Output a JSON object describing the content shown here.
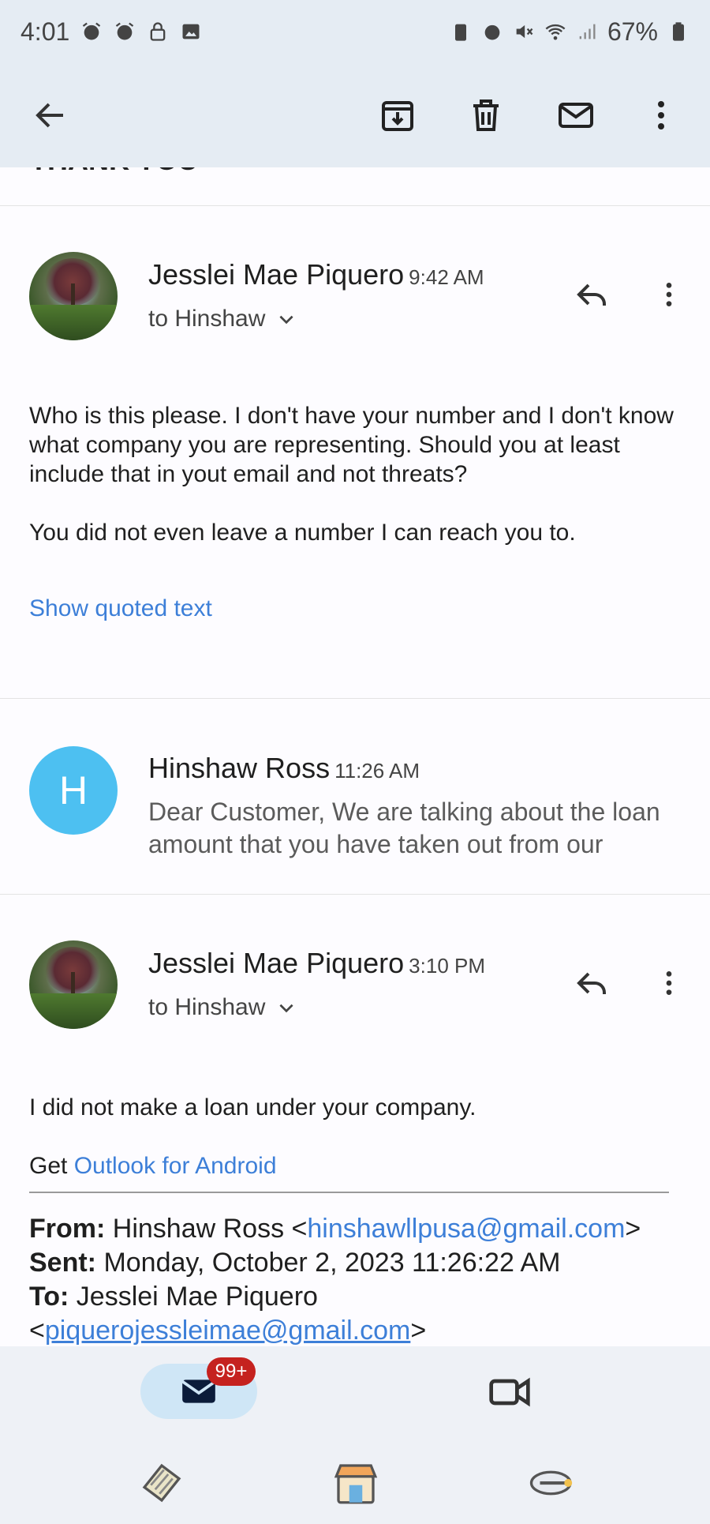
{
  "status_bar": {
    "time": "4:01",
    "battery": "67%"
  },
  "app_bar": {
    "icons": [
      "back-arrow-icon",
      "archive-icon",
      "delete-icon",
      "mark-unread-icon",
      "more-vert-icon"
    ]
  },
  "messages": [
    {
      "sender": "Jesslei Mae Piquero",
      "time": "9:42 AM",
      "recipient": "to Hinshaw",
      "body": [
        "Who is this please. I don't have your number and I don't know what company you are representing. Should you at least include that in yout email and not threats?",
        "You did not even leave a number I can reach you to."
      ],
      "show_quoted": "Show quoted text"
    },
    {
      "sender": "Hinshaw Ross",
      "avatar_letter": "H",
      "time": "11:26 AM",
      "snippet": "Dear Customer, We are talking about the loan amount that you have taken out from our"
    },
    {
      "sender": "Jesslei Mae Piquero",
      "time": "3:10 PM",
      "recipient": "to Hinshaw",
      "body": [
        "I did not make a loan under your company."
      ],
      "signature_prefix": "Get ",
      "signature_link": "Outlook for Android",
      "quoted_header": {
        "from_label": "From:",
        "from_name": "Hinshaw Ross <",
        "from_email": "hinshawllpusa@gmail.com",
        "from_close": ">",
        "sent_label": "Sent:",
        "sent_value": "Monday, October 2, 2023 11:26:22 AM",
        "to_label": "To:",
        "to_name": "Jesslei Mae Piquero",
        "to_open": "<",
        "to_email": "piquerojessleimae@gmail.com",
        "to_close": ">"
      }
    }
  ],
  "bottom_nav": {
    "mail_badge": "99+",
    "icons": [
      "mail-icon",
      "video-camera-icon"
    ]
  },
  "dock": {
    "icons": [
      "app-icon-ticket",
      "app-icon-store",
      "app-icon-pen"
    ]
  },
  "colors": {
    "link": "#3d7fd8",
    "avatar_h": "#4dc0f1",
    "badge": "#c5221f",
    "top_bg": "#e5ecf3"
  }
}
